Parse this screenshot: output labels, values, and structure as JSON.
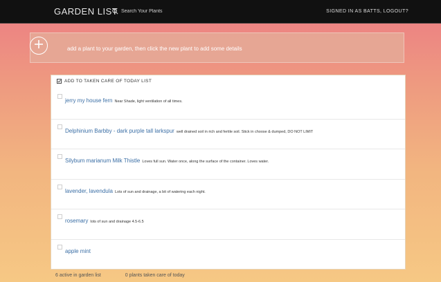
{
  "header": {
    "brand": "GARDEN LIST",
    "search_placeholder": "Search Your Plants",
    "user": "SIGNED IN AS BATTS",
    "logout": "LOGOUT?"
  },
  "add_panel": {
    "hint": "add a plant to your garden, then click the new plant to add some details"
  },
  "list": {
    "header": "ADD TO TAKEN CARE OF TODAY LIST",
    "items": [
      {
        "name": "jerry my house fern",
        "note": "Near Shade, light ventilation of all times."
      },
      {
        "name": "Delphinium Barbby - dark purple tall larkspur",
        "note": "well drained soil in rich and fertile soil. Stick in choose & dumped, DO NOT LIMIT"
      },
      {
        "name": "Silybum marianum Milk Thistle",
        "note": "Loves full sun. Water once, along the surface of the container. Loves water."
      },
      {
        "name": "lavender, lavendula",
        "note": "Lots of sun and drainage, a bit of watering each night."
      },
      {
        "name": "rosemary",
        "note": "lots of sun and drainage 4.5-6.5"
      },
      {
        "name": "apple mint",
        "note": ""
      }
    ]
  },
  "footer": {
    "active": "6 active in garden list",
    "watered": "0 plants taken care of today"
  },
  "colors": {
    "topbar": "#111111",
    "link": "#3a6ea5"
  }
}
